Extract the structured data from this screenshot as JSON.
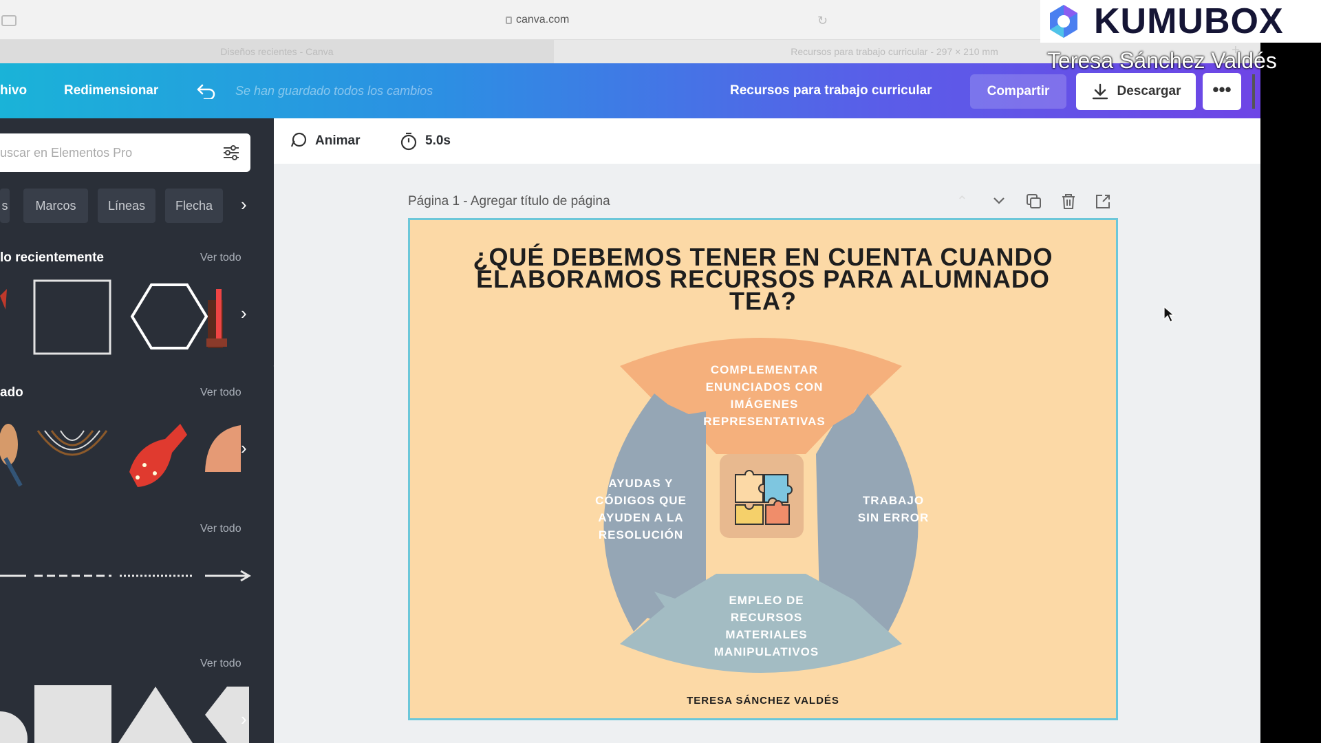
{
  "browser": {
    "url": "canva.com",
    "tabs": [
      "Diseños recientes - Canva",
      "Recursos para trabajo curricular - 297 × 210 mm"
    ],
    "new_tab": "+"
  },
  "header": {
    "file_menu": "hivo",
    "resize": "Redimensionar",
    "save_status": "Se han guardado todos los cambios",
    "design_name": "Recursos para trabajo curricular",
    "share": "Compartir",
    "download": "Descargar",
    "more": "•••"
  },
  "sidebar": {
    "search_placeholder": "uscar en Elementos Pro",
    "chips": [
      "s",
      "Marcos",
      "Líneas",
      "Flecha"
    ],
    "sections": [
      {
        "title": "lo recientemente",
        "see_all": "Ver todo"
      },
      {
        "title": "ado",
        "see_all": "Ver todo"
      },
      {
        "title": "",
        "see_all": "Ver todo"
      },
      {
        "title": "",
        "see_all": "Ver todo"
      }
    ]
  },
  "toolbar": {
    "animate": "Animar",
    "duration": "5.0s"
  },
  "page": {
    "label": "Página 1 - Agregar título de página"
  },
  "design": {
    "title_lines": [
      "¿QUÉ DEBEMOS TENER EN CUENTA CUANDO",
      "ELABORAMOS RECURSOS PARA ALUMNADO",
      "TEA?"
    ],
    "petals": {
      "top": [
        "COMPLEMENTAR",
        "ENUNCIADOS CON",
        "IMÁGENES",
        "REPRESENTATIVAS"
      ],
      "left": [
        "AYUDAS Y",
        "CÓDIGOS QUE",
        "AYUDEN A LA",
        "RESOLUCIÓN"
      ],
      "right": [
        "TRABAJO",
        "SIN ERROR"
      ],
      "bottom": [
        "EMPLEO DE",
        "RECURSOS",
        "MATERIALES",
        "MANIPULATIVOS"
      ]
    },
    "author": "TERESA SÁNCHEZ VALDÉS",
    "colors": {
      "background": "#fcd9a6",
      "petal_top": "#f5b07c",
      "petal_side": "#95a6b5",
      "petal_bottom": "#a3bcc3",
      "center": "#e8b98f"
    }
  },
  "watermark": {
    "brand": "KUMUBOX",
    "presenter": "Teresa Sánchez Valdés"
  },
  "colors": {
    "header_gradient_start": "#1ab3d8",
    "header_gradient_end": "#6e45e6",
    "sidebar_bg": "#2a2f38",
    "selection": "#6cc7d9"
  }
}
